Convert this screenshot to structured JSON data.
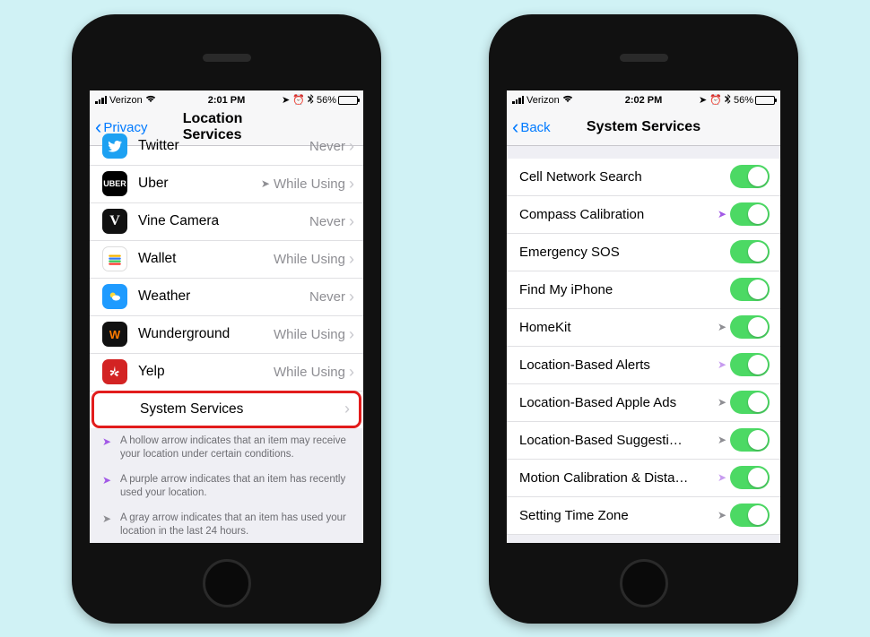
{
  "left": {
    "status": {
      "carrier": "Verizon",
      "time": "2:01 PM",
      "battery_pct": "56%"
    },
    "nav": {
      "back": "Privacy",
      "title": "Location Services"
    },
    "rows": [
      {
        "app": "Twitter",
        "value": "Never"
      },
      {
        "app": "Uber",
        "value": "While Using",
        "arrow": "gray"
      },
      {
        "app": "Vine Camera",
        "value": "Never"
      },
      {
        "app": "Wallet",
        "value": "While Using"
      },
      {
        "app": "Weather",
        "value": "Never"
      },
      {
        "app": "Wunderground",
        "value": "While Using"
      },
      {
        "app": "Yelp",
        "value": "While Using"
      }
    ],
    "system_services_label": "System Services",
    "footer": {
      "hollow": "A hollow arrow indicates that an item may receive your location under certain conditions.",
      "purple": "A purple arrow indicates that an item has recently used your location.",
      "gray": "A gray arrow indicates that an item has used your location in the last 24 hours."
    }
  },
  "right": {
    "status": {
      "carrier": "Verizon",
      "time": "2:02 PM",
      "battery_pct": "56%"
    },
    "nav": {
      "back": "Back",
      "title": "System Services"
    },
    "rows": [
      {
        "label": "Cell Network Search",
        "on": true
      },
      {
        "label": "Compass Calibration",
        "on": true,
        "arrow": "purple"
      },
      {
        "label": "Emergency SOS",
        "on": true
      },
      {
        "label": "Find My iPhone",
        "on": true
      },
      {
        "label": "HomeKit",
        "on": true,
        "arrow": "gray"
      },
      {
        "label": "Location-Based Alerts",
        "on": true,
        "arrow": "hollow"
      },
      {
        "label": "Location-Based Apple Ads",
        "on": true,
        "arrow": "gray"
      },
      {
        "label": "Location-Based Suggesti…",
        "on": true,
        "arrow": "gray"
      },
      {
        "label": "Motion Calibration & Dista…",
        "on": true,
        "arrow": "hollow"
      },
      {
        "label": "Setting Time Zone",
        "on": true,
        "arrow": "gray"
      }
    ]
  }
}
